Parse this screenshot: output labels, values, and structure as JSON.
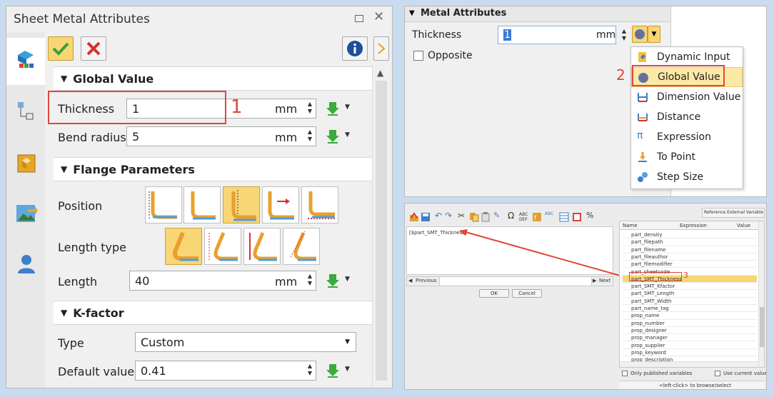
{
  "left_panel": {
    "title": "Sheet Metal Attributes",
    "sections": {
      "global_value": "Global Value",
      "flange_parameters": "Flange Parameters",
      "k_factor": "K-factor"
    },
    "fields": {
      "thickness_label": "Thickness",
      "thickness_value": "1",
      "thickness_unit": "mm",
      "bend_radius_label": "Bend radius",
      "bend_radius_value": "5",
      "bend_radius_unit": "mm",
      "position_label": "Position",
      "length_type_label": "Length type",
      "length_label": "Length",
      "length_value": "40",
      "length_unit": "mm",
      "type_label": "Type",
      "type_value": "Custom",
      "default_value_label": "Default value",
      "default_value": "0.41"
    },
    "annotation": "1"
  },
  "top_right": {
    "header": "Metal Attributes",
    "thickness_label": "Thickness",
    "thickness_value": "1",
    "unit": "mm",
    "opposite_label": "Opposite",
    "annotation": "2",
    "menu": [
      {
        "label": "Dynamic Input"
      },
      {
        "label": "Global Value"
      },
      {
        "label": "Dimension Value"
      },
      {
        "label": "Distance"
      },
      {
        "label": "Expression"
      },
      {
        "label": "To Point"
      },
      {
        "label": "Step Size"
      }
    ]
  },
  "bottom_right": {
    "expression_text": "[$part_SMT_Thickness]",
    "previous_label": "Previous",
    "next_label": "Next",
    "ok_label": "OK",
    "cancel_label": "Cancel",
    "reference_button": "Reference External Variable",
    "columns": [
      "Name",
      "Expression",
      "Value"
    ],
    "variables": [
      "part_density",
      "part_filepath",
      "part_filename",
      "part_fileauthor",
      "part_filemodifier",
      "part_sheetcode",
      "part_SMT_Thickness",
      "part_SMT_Kfactor",
      "part_SMT_Length",
      "part_SMT_Width",
      "part_name_tag",
      "prop_name",
      "prop_number",
      "prop_designer",
      "prop_manager",
      "prop_supplier",
      "prop_keyword",
      "prop_description"
    ],
    "only_published_label": "Only published variables",
    "use_current_label": "Use current value",
    "status_text": "<left-click> to browse/select",
    "annotation": "3"
  }
}
